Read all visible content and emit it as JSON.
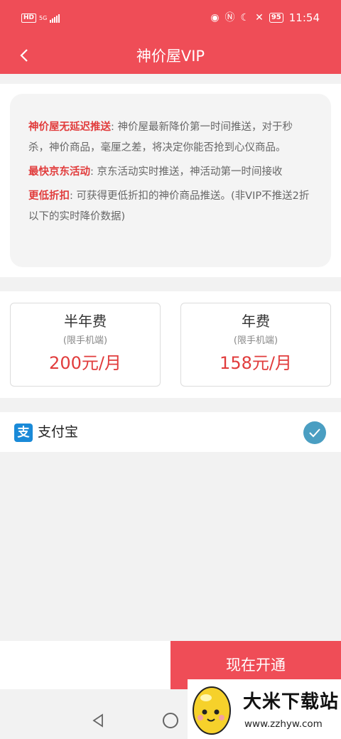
{
  "status_bar": {
    "hd": "HD",
    "network": "5G",
    "battery": "95",
    "time": "11:54"
  },
  "header": {
    "title": "神价屋VIP",
    "back_icon": "chevron-left-icon"
  },
  "description": {
    "items": [
      {
        "highlight": "神价屋无延迟推送",
        "text": ": 神价屋最新降价第一时间推送，对于秒杀，神价商品，毫厘之差，将决定你能否抢到心仪商品。"
      },
      {
        "highlight": "最快京东活动",
        "text": ": 京东活动实时推送，神活动第一时间接收"
      },
      {
        "highlight": "更低折扣",
        "text": ": 可获得更低折扣的神价商品推送。(非VIP不推送2折以下的实时降价数据)"
      }
    ]
  },
  "plans": [
    {
      "name": "半年费",
      "note": "(限手机端)",
      "price": "200元/月"
    },
    {
      "name": "年费",
      "note": "(限手机端)",
      "price": "158元/月"
    }
  ],
  "payment": {
    "icon_char": "支",
    "label": "支付宝",
    "selected": true
  },
  "action": {
    "button_label": "现在开通"
  },
  "watermark": {
    "title": "大米下载站",
    "url": "www.zzhyw.com"
  },
  "colors": {
    "brand_red": "#ef4d57",
    "highlight_red": "#e13c3c",
    "alipay_blue": "#1a8ad8",
    "check_blue": "#4a9ec2"
  }
}
